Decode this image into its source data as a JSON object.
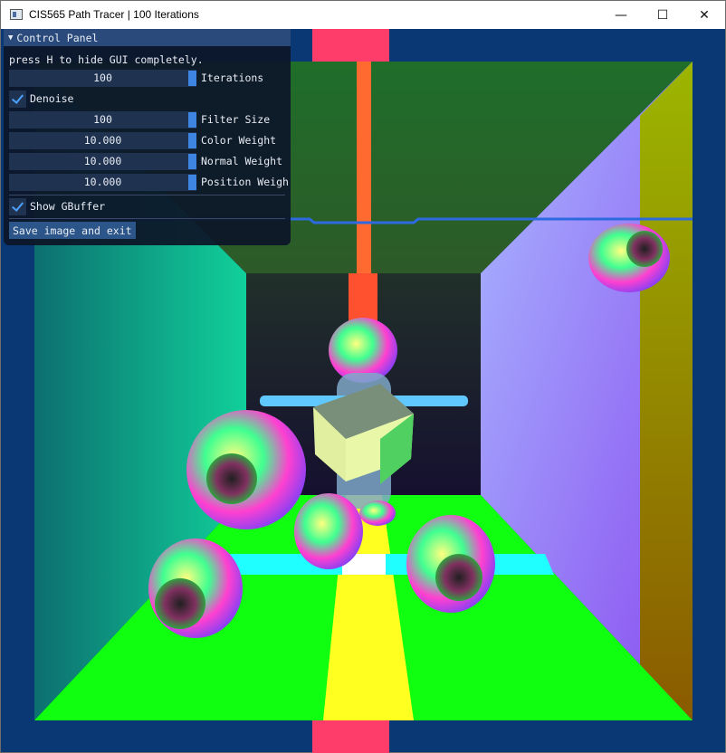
{
  "window": {
    "title": "CIS565 Path Tracer | 100 Iterations",
    "controls": {
      "minimize": "—",
      "maximize": "☐",
      "close": "✕"
    }
  },
  "panel": {
    "header": "Control Panel",
    "hint": "press H to hide GUI completely.",
    "sliders": [
      {
        "value": "100",
        "label": "Iterations"
      },
      {
        "value": "100",
        "label": "Filter Size"
      },
      {
        "value": "10.000",
        "label": "Color Weight"
      },
      {
        "value": "10.000",
        "label": "Normal Weight"
      },
      {
        "value": "10.000",
        "label": "Position Weigh"
      }
    ],
    "denoise": {
      "label": "Denoise",
      "checked": true
    },
    "gbuffer": {
      "label": "Show GBuffer",
      "checked": true
    },
    "save_button": "Save image and exit"
  },
  "colors": {
    "background": "#0a3875",
    "panel_bg": "#0d1628",
    "panel_header": "#294a7a",
    "slider_bg": "#1f3350",
    "accent": "#3d85e0",
    "floor": "#10ff10",
    "light_strip": "#ff3d6b"
  }
}
